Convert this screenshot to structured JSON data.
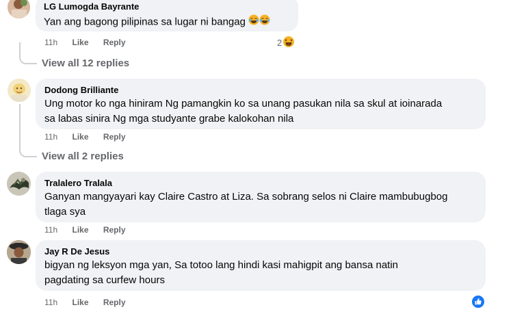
{
  "comments": [
    {
      "name": "LG Lumogda Bayrante",
      "text_lines": [
        "Yan ang bagong pilipinas sa lugar ni bangag"
      ],
      "emojis": [
        "laughing-tears-emoji",
        "laughing-tears-emoji"
      ],
      "time": "11h",
      "like": "Like",
      "reply": "Reply",
      "reaction_count": "2",
      "reaction_icon": "haha-reaction-icon",
      "view_replies": "View all 12 replies"
    },
    {
      "name": "Dodong Brilliante",
      "text_lines": [
        "Ung motor ko nga hiniram Ng pamangkin ko sa unang pasukan nila sa skul at ioinarada",
        "sa labas sinira Ng mga studyante grabe kalokohan nila"
      ],
      "time": "11h",
      "like": "Like",
      "reply": "Reply",
      "view_replies": "View all 2 replies"
    },
    {
      "name": "Tralalero Tralala",
      "text_lines": [
        "Ganyan mangyayari kay Claire Castro at Liza. Sa sobrang selos ni Claire mambubugbog",
        "tlaga sya"
      ],
      "time": "11h",
      "like": "Like",
      "reply": "Reply"
    },
    {
      "name": "Jay R De Jesus",
      "text_lines": [
        "bigyan ng leksyon mga yan, Sa totoo lang hindi kasi mahigpit ang bansa natin",
        "pagdating sa curfew hours"
      ],
      "time": "11h",
      "like": "Like",
      "reply": "Reply",
      "reaction_icon": "like-reaction-icon"
    }
  ],
  "colors": {
    "bubble": "#f0f2f5",
    "meta_text": "#65676b",
    "thread_line": "#ced0d4",
    "like_blue": "#1877f2",
    "haha_yellow": "#f7b125"
  }
}
